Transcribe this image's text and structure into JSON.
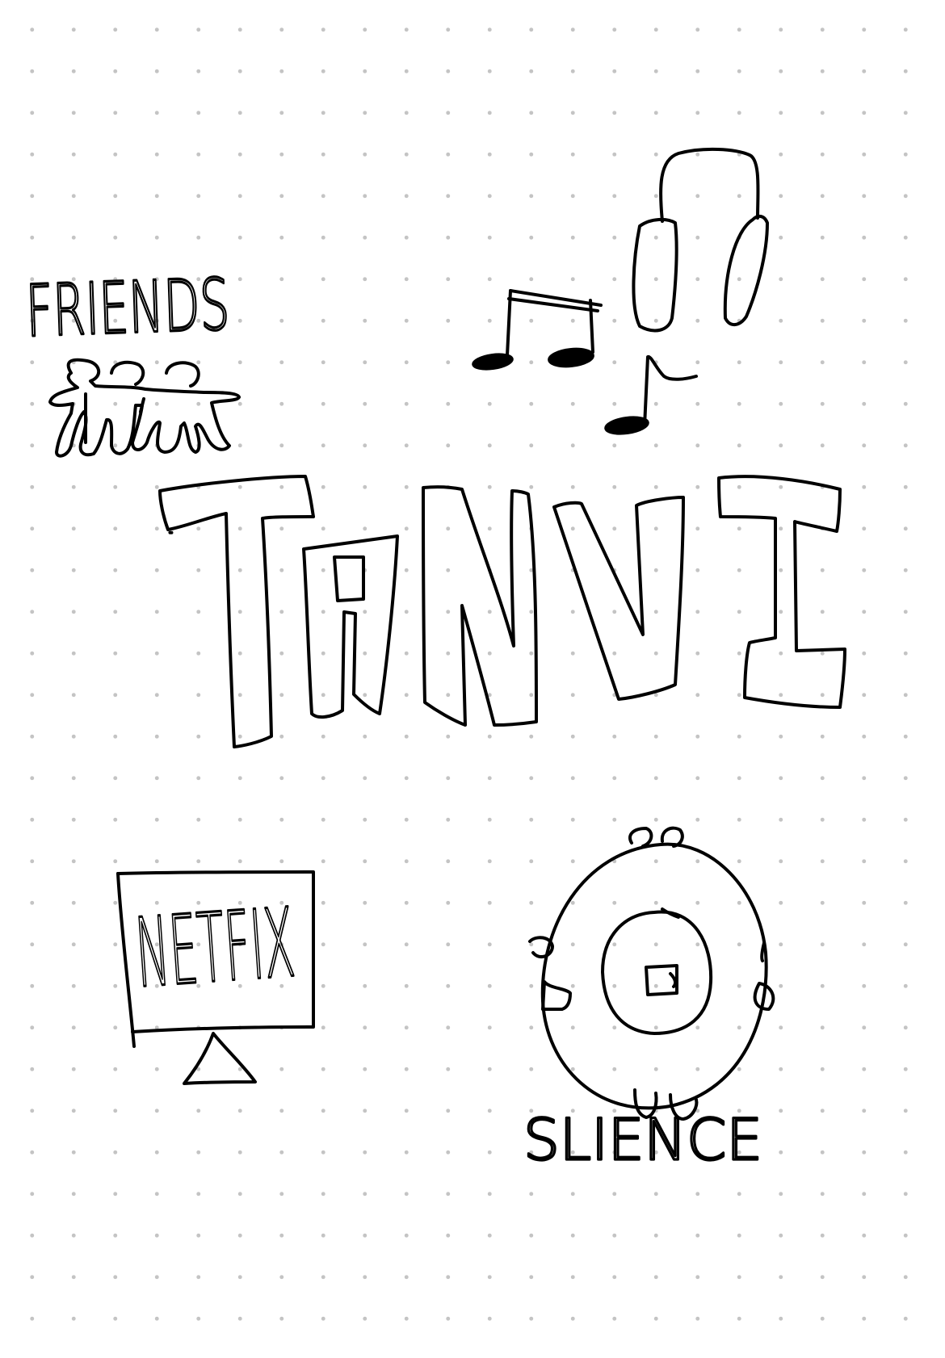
{
  "canvas": {
    "background": "#ffffff",
    "grid_style": "dots",
    "grid_dot_color": "#c4c4c4",
    "ink_color": "#000000"
  },
  "doodles": {
    "name_title": "TANVI",
    "friends": {
      "label": "FRIENDS",
      "icon": "people-holding-hands-icon"
    },
    "music": {
      "icons": [
        "music-notes-icon",
        "headphones-icon"
      ]
    },
    "netflix": {
      "label": "NETFIX",
      "icon": "tv-monitor-icon"
    },
    "science": {
      "label": "SLIENCE",
      "icon": "atom-icon"
    }
  }
}
